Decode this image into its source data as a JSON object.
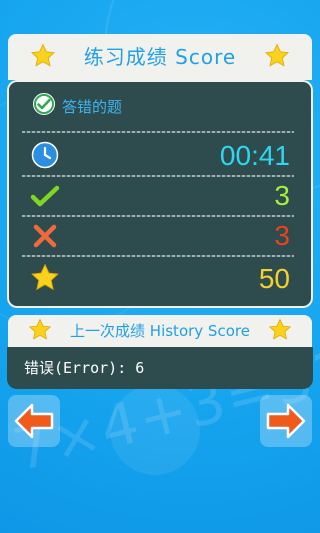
{
  "score": {
    "title": "练习成绩 Score",
    "section_label": "答错的题",
    "time": "00:41",
    "correct": "3",
    "wrong": "3",
    "points": "50",
    "colors": {
      "time": "#2fd6f0",
      "correct": "#a4f03a",
      "wrong": "#e8431c",
      "points": "#f4d22a"
    },
    "icons": [
      "check-circle-icon",
      "clock-icon",
      "checkmark-icon",
      "cross-icon",
      "star-icon"
    ]
  },
  "history": {
    "title": "上一次成绩 History Score",
    "error_text": "错误(Error): 6"
  },
  "nav": {
    "prev_icon": "arrow-left-icon",
    "next_icon": "arrow-right-icon"
  },
  "background": {
    "formula": "7×4+3=31"
  }
}
